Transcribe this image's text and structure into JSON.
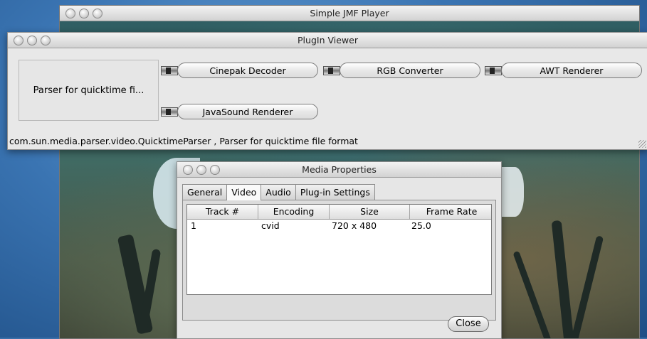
{
  "player": {
    "title": "Simple JMF Player"
  },
  "plugin_viewer": {
    "title": "PlugIn Viewer",
    "parser_label": "Parser for quicktime fi...",
    "nodes": [
      "Cinepak Decoder",
      "RGB Converter",
      "AWT Renderer",
      "JavaSound Renderer"
    ],
    "status": "com.sun.media.parser.video.QuicktimeParser , Parser for quicktime file format"
  },
  "media_properties": {
    "title": "Media Properties",
    "tabs": [
      "General",
      "Video",
      "Audio",
      "Plug-in Settings"
    ],
    "active_tab": "Video",
    "table": {
      "headers": [
        "Track #",
        "Encoding",
        "Size",
        "Frame Rate"
      ],
      "rows": [
        [
          "1",
          "cvid",
          "720 x 480",
          "25.0"
        ]
      ]
    },
    "close_label": "Close"
  }
}
